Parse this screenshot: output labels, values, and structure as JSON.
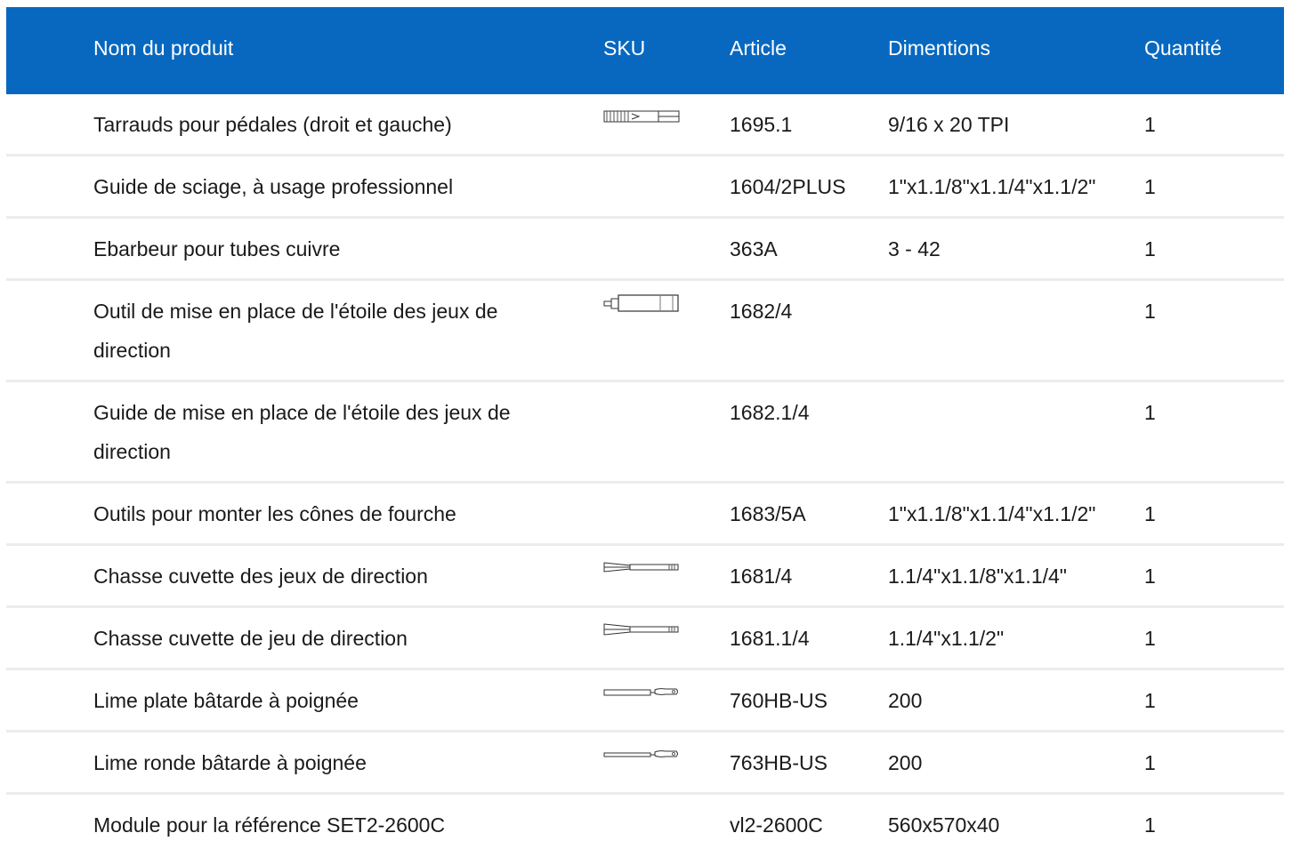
{
  "table": {
    "headers": {
      "name": "Nom du produit",
      "sku": "SKU",
      "article": "Article",
      "dimensions": "Dimentions",
      "quantity": "Quantité"
    },
    "rows": [
      {
        "name": "Tarrauds pour pédales (droit et gauche)",
        "article": "1695.1",
        "dimensions": "9/16 x 20 TPI",
        "quantity": "1",
        "icon": "pedal-tap-icon"
      },
      {
        "name": "Guide de sciage, à usage professionnel",
        "article": "1604/2PLUS",
        "dimensions": "1\"x1.1/8\"x1.1/4\"x1.1/2\"",
        "quantity": "1",
        "icon": ""
      },
      {
        "name": "Ebarbeur pour tubes cuivre",
        "article": "363A",
        "dimensions": "3 - 42",
        "quantity": "1",
        "icon": ""
      },
      {
        "name": "Outil de mise en place de l'étoile des jeux de direction",
        "article": "1682/4",
        "dimensions": "",
        "quantity": "1",
        "icon": "star-nut-setter-icon"
      },
      {
        "name": "Guide de mise en place de l'étoile des jeux de direction",
        "article": "1682.1/4",
        "dimensions": "",
        "quantity": "1",
        "icon": ""
      },
      {
        "name": "Outils pour monter les cônes de fourche",
        "article": "1683/5A",
        "dimensions": "1\"x1.1/8\"x1.1/4\"x1.1/2\"",
        "quantity": "1",
        "icon": ""
      },
      {
        "name": "Chasse cuvette des jeux de direction",
        "article": "1681/4",
        "dimensions": "1.1/4\"x1.1/8\"x1.1/4\"",
        "quantity": "1",
        "icon": "cup-remover-icon"
      },
      {
        "name": "Chasse cuvette de jeu de direction",
        "article": "1681.1/4",
        "dimensions": "1.1/4\"x1.1/2\"",
        "quantity": "1",
        "icon": "cup-remover-icon"
      },
      {
        "name": "Lime plate bâtarde à poignée",
        "article": "760HB-US",
        "dimensions": "200",
        "quantity": "1",
        "icon": "flat-file-icon"
      },
      {
        "name": "Lime ronde bâtarde à poignée",
        "article": "763HB-US",
        "dimensions": "200",
        "quantity": "1",
        "icon": "round-file-icon"
      },
      {
        "name": "Module pour la référence SET2-2600C",
        "article": "vl2-2600C",
        "dimensions": "560x570x40",
        "quantity": "1",
        "icon": ""
      }
    ]
  }
}
